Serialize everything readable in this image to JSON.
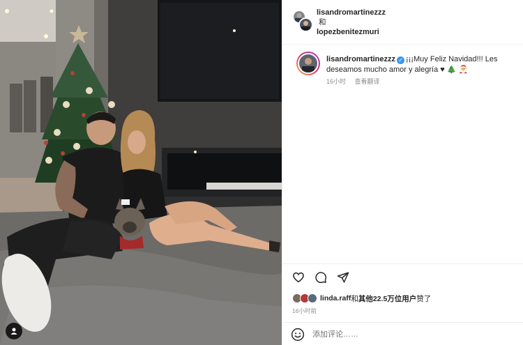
{
  "header": {
    "user1": "lisandromartinezzz",
    "joiner": "和",
    "user2": "lopezbenitezmuri"
  },
  "caption": {
    "username": "lisandromartinezzz",
    "verified_icon": "verified-badge-icon",
    "text": "¡¡¡Muy Feliz Navidad!!! Les deseamos mucho amor y alegría ♥ 🎄 🎅",
    "time": "16小时",
    "translate": "查看翻译"
  },
  "actions": {
    "icons": [
      "heart-icon",
      "comment-icon",
      "share-icon"
    ]
  },
  "likes": {
    "user": "linda.raff",
    "joiner": "和",
    "others": "其他22.5万位用户",
    "suffix": "赞了"
  },
  "timestamp": "16小时前",
  "comment": {
    "placeholder": "添加评论……",
    "emoji_icon": "emoji-icon"
  },
  "photo": {
    "tag_icon": "user-tag-icon"
  },
  "colors": {
    "verified": "#3897f0",
    "secondary_text": "#8e8e8e",
    "border": "#efefef"
  }
}
